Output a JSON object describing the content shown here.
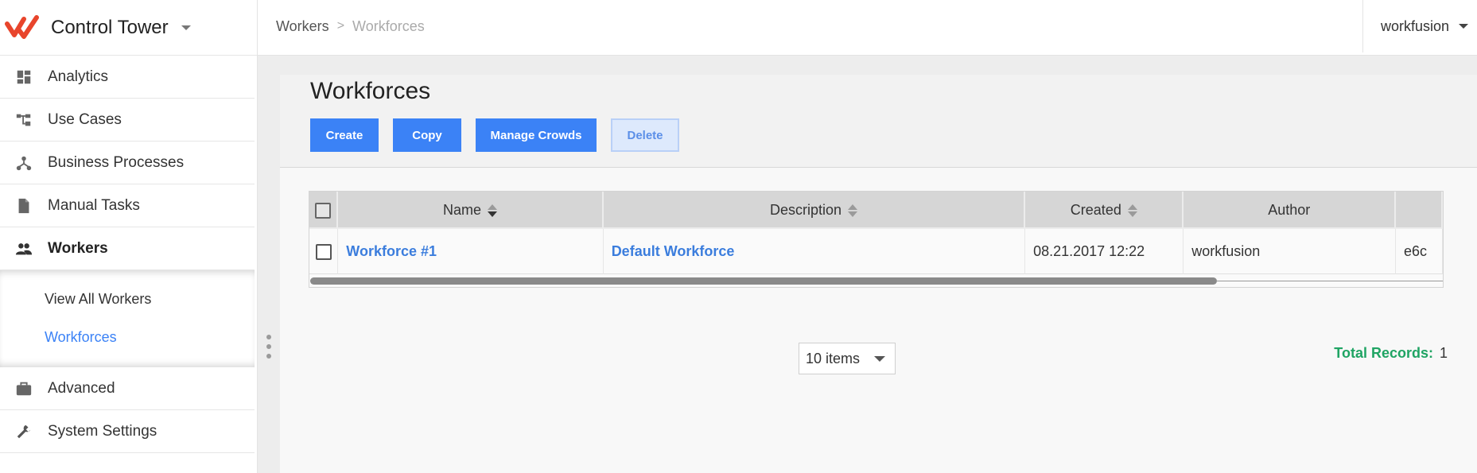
{
  "app": {
    "title": "Control Tower"
  },
  "colors": {
    "accent": "#3b82f6",
    "link": "#3b7ddd",
    "total_label": "#1fa463",
    "logo": "#e8452c"
  },
  "sidebar": {
    "items": [
      {
        "label": "Analytics",
        "icon": "dashboard-icon"
      },
      {
        "label": "Use Cases",
        "icon": "hierarchy-icon"
      },
      {
        "label": "Business Processes",
        "icon": "process-nodes-icon"
      },
      {
        "label": "Manual Tasks",
        "icon": "document-icon"
      },
      {
        "label": "Workers",
        "icon": "people-icon",
        "active": true
      },
      {
        "label": "Advanced",
        "icon": "briefcase-icon"
      },
      {
        "label": "System Settings",
        "icon": "wrench-icon"
      }
    ],
    "workers_sub": [
      {
        "label": "View All Workers"
      },
      {
        "label": "Workforces",
        "current": true
      }
    ]
  },
  "topbar": {
    "breadcrumb": [
      "Workers",
      "Workforces"
    ],
    "breadcrumb_sep": ">",
    "user": "workfusion"
  },
  "page": {
    "title": "Workforces",
    "buttons": {
      "create": "Create",
      "copy": "Copy",
      "manage_crowds": "Manage Crowds",
      "delete": "Delete"
    }
  },
  "table": {
    "columns": [
      "Name",
      "Description",
      "Created",
      "Author"
    ],
    "rows": [
      {
        "name": "Workforce #1",
        "description": "Default Workforce",
        "created": "08.21.2017 12:22",
        "author": "workfusion",
        "extra": "e6c"
      }
    ]
  },
  "pagination": {
    "page_size": "10 items"
  },
  "totals": {
    "label": "Total Records:",
    "value": "1"
  }
}
